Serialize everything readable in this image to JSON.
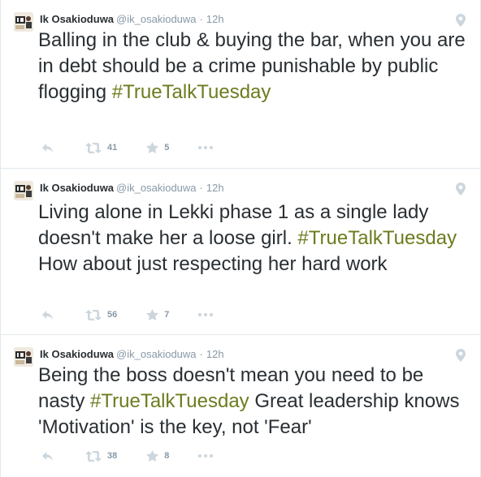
{
  "colors": {
    "hashtag": "#6e7b1e",
    "meta": "#8899a6",
    "text": "#292f33",
    "divider": "#e1e8ed"
  },
  "icons": {
    "reply": "reply-icon",
    "retweet": "retweet-icon",
    "favorite": "star-icon",
    "more": "more-dots-icon",
    "location": "location-pin-icon"
  },
  "tweets": [
    {
      "name": "Ik Osakioduwa",
      "handle": "@ik_osakioduwa",
      "separator": "·",
      "time": "12h",
      "text_before": "Balling in the club & buying the bar, when you are in debt should be a crime punishable by public flogging ",
      "hashtag": "#TrueTalkTuesday",
      "text_after": "",
      "retweets": "41",
      "favorites": "5"
    },
    {
      "name": "Ik Osakioduwa",
      "handle": "@ik_osakioduwa",
      "separator": "·",
      "time": "12h",
      "text_before": "Living alone in Lekki phase 1 as a single lady doesn't make her a loose girl. ",
      "hashtag": "#TrueTalkTuesday",
      "text_after": " How about just respecting her hard work",
      "retweets": "56",
      "favorites": "7"
    },
    {
      "name": "Ik Osakioduwa",
      "handle": "@ik_osakioduwa",
      "separator": "·",
      "time": "12h",
      "text_before": "Being the boss doesn't mean you need to be nasty ",
      "hashtag": "#TrueTalkTuesday",
      "text_after": " Great leadership knows 'Motivation' is the key, not 'Fear'",
      "retweets": "38",
      "favorites": "8"
    }
  ]
}
